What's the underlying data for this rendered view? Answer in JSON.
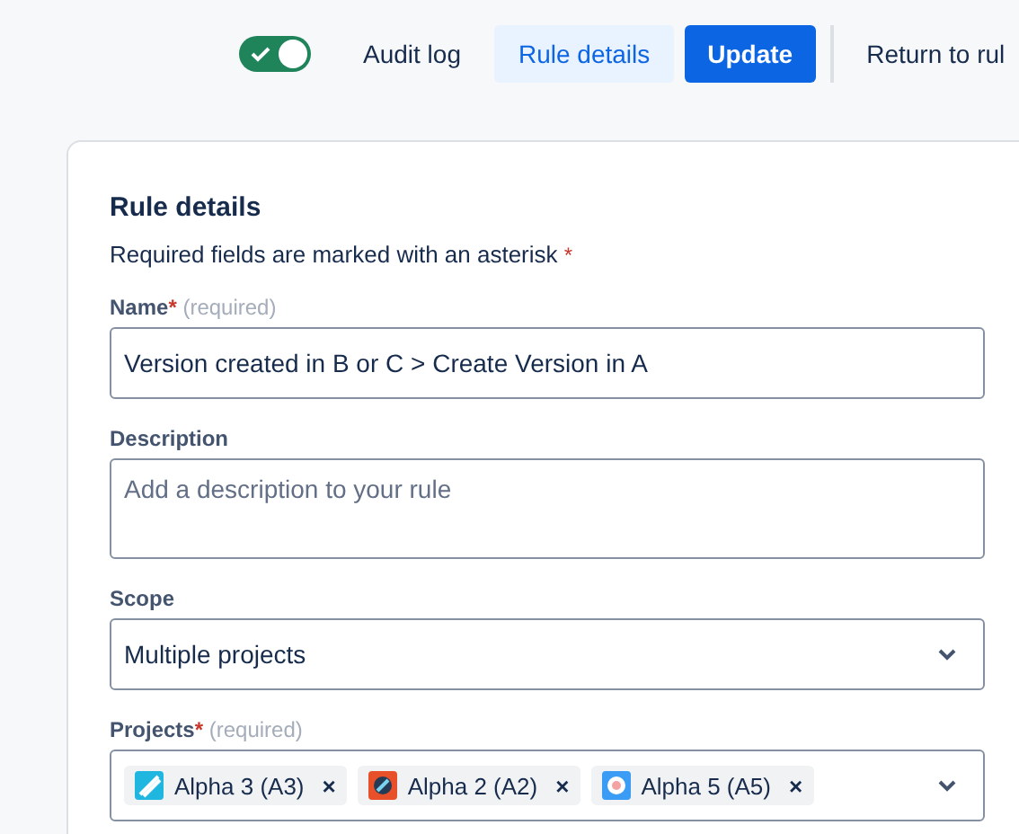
{
  "header": {
    "toggle": {
      "on": true
    },
    "buttons": [
      {
        "label": "Audit log",
        "kind": "subtle",
        "selected": false
      },
      {
        "label": "Rule details",
        "kind": "subtle",
        "selected": true
      },
      {
        "label": "Update",
        "kind": "primary",
        "selected": false
      },
      {
        "label": "Return to rul",
        "kind": "link",
        "selected": false
      }
    ]
  },
  "form": {
    "title": "Rule details",
    "note": "Required fields are marked with an asterisk",
    "note_mark": "*",
    "name": {
      "label": "Name",
      "mark": "*",
      "hint": "(required)",
      "value": "Version created in B or C > Create Version in A"
    },
    "description": {
      "label": "Description",
      "placeholder": "Add a description to your rule"
    },
    "scope": {
      "label": "Scope",
      "value": "Multiple projects"
    },
    "projects": {
      "label": "Projects",
      "mark": "*",
      "hint": "(required)",
      "items": [
        {
          "label": "Alpha 3 (A3)",
          "remove": "×"
        },
        {
          "label": "Alpha 2 (A2)",
          "remove": "×"
        },
        {
          "label": "Alpha 5 (A5)",
          "remove": "×"
        }
      ]
    }
  }
}
